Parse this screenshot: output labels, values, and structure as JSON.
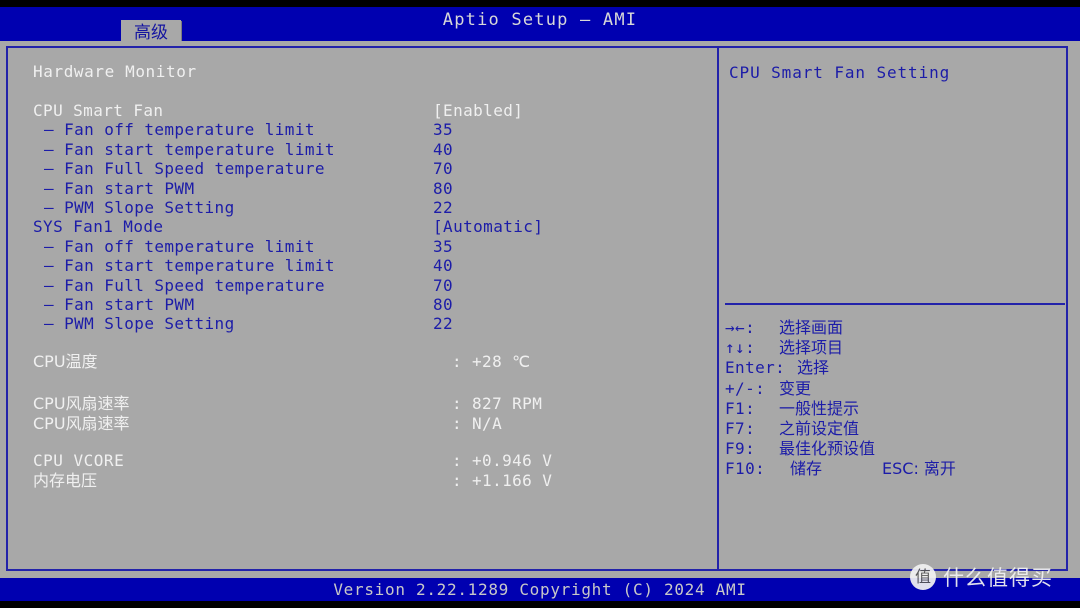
{
  "header": {
    "title": "Aptio Setup – AMI",
    "active_tab": "高级"
  },
  "left_panel": {
    "section_title": "Hardware Monitor",
    "settings": [
      {
        "label": "CPU Smart Fan",
        "value": "[Enabled]",
        "indent": false,
        "highlight": true
      },
      {
        "label": "– Fan off temperature limit",
        "value": "35",
        "indent": true,
        "highlight": false
      },
      {
        "label": "– Fan start temperature limit",
        "value": "40",
        "indent": true,
        "highlight": false
      },
      {
        "label": "– Fan Full Speed temperature",
        "value": "70",
        "indent": true,
        "highlight": false
      },
      {
        "label": "– Fan start PWM",
        "value": "80",
        "indent": true,
        "highlight": false
      },
      {
        "label": "– PWM Slope Setting",
        "value": "22",
        "indent": true,
        "highlight": false
      },
      {
        "label": "SYS Fan1 Mode",
        "value": "[Automatic]",
        "indent": false,
        "highlight": false
      },
      {
        "label": "– Fan off temperature limit",
        "value": "35",
        "indent": true,
        "highlight": false
      },
      {
        "label": "– Fan start temperature limit",
        "value": "40",
        "indent": true,
        "highlight": false
      },
      {
        "label": "– Fan Full Speed temperature",
        "value": "70",
        "indent": true,
        "highlight": false
      },
      {
        "label": "– Fan start PWM",
        "value": "80",
        "indent": true,
        "highlight": false
      },
      {
        "label": "– PWM Slope Setting",
        "value": "22",
        "indent": true,
        "highlight": false
      }
    ],
    "sensors": [
      {
        "label": "CPU温度",
        "colon": ":",
        "value": "+28 ℃",
        "mono": false
      },
      {
        "label": "CPU风扇速率",
        "colon": ":",
        "value": "827 RPM",
        "mono": false
      },
      {
        "label": "CPU风扇速率",
        "colon": ":",
        "value": "N/A",
        "mono": false
      },
      {
        "label": "CPU VCORE",
        "colon": ":",
        "value": "+0.946 V",
        "mono": true
      },
      {
        "label": "内存电压",
        "colon": ":",
        "value": "+1.166 V",
        "mono": false
      }
    ]
  },
  "right_panel": {
    "help_title": "CPU Smart Fan Setting",
    "keys": [
      {
        "key": "→←:",
        "desc": "选择画面",
        "extra": ""
      },
      {
        "key": "↑↓:",
        "desc": "选择项目",
        "extra": ""
      },
      {
        "key": "Enter:",
        "desc": "选择",
        "extra": ""
      },
      {
        "key": "+/-:",
        "desc": "变更",
        "extra": ""
      },
      {
        "key": "F1:",
        "desc": "一般性提示",
        "extra": ""
      },
      {
        "key": "F7:",
        "desc": "之前设定值",
        "extra": ""
      },
      {
        "key": "F9:",
        "desc": "最佳化预设值",
        "extra": ""
      },
      {
        "key": "F10:",
        "desc": "储存",
        "extra": "ESC: 离开"
      }
    ]
  },
  "footer": {
    "version_text": "Version 2.22.1289 Copyright (C) 2024 AMI"
  },
  "watermark": {
    "logo_char": "值",
    "text": "什么值得买"
  },
  "colors": {
    "header_blue": "#0000b0",
    "panel_gray": "#a8a8a8",
    "border_blue": "#2222aa",
    "text_blue": "#1c1ca8",
    "text_white": "#f0f0f0"
  }
}
